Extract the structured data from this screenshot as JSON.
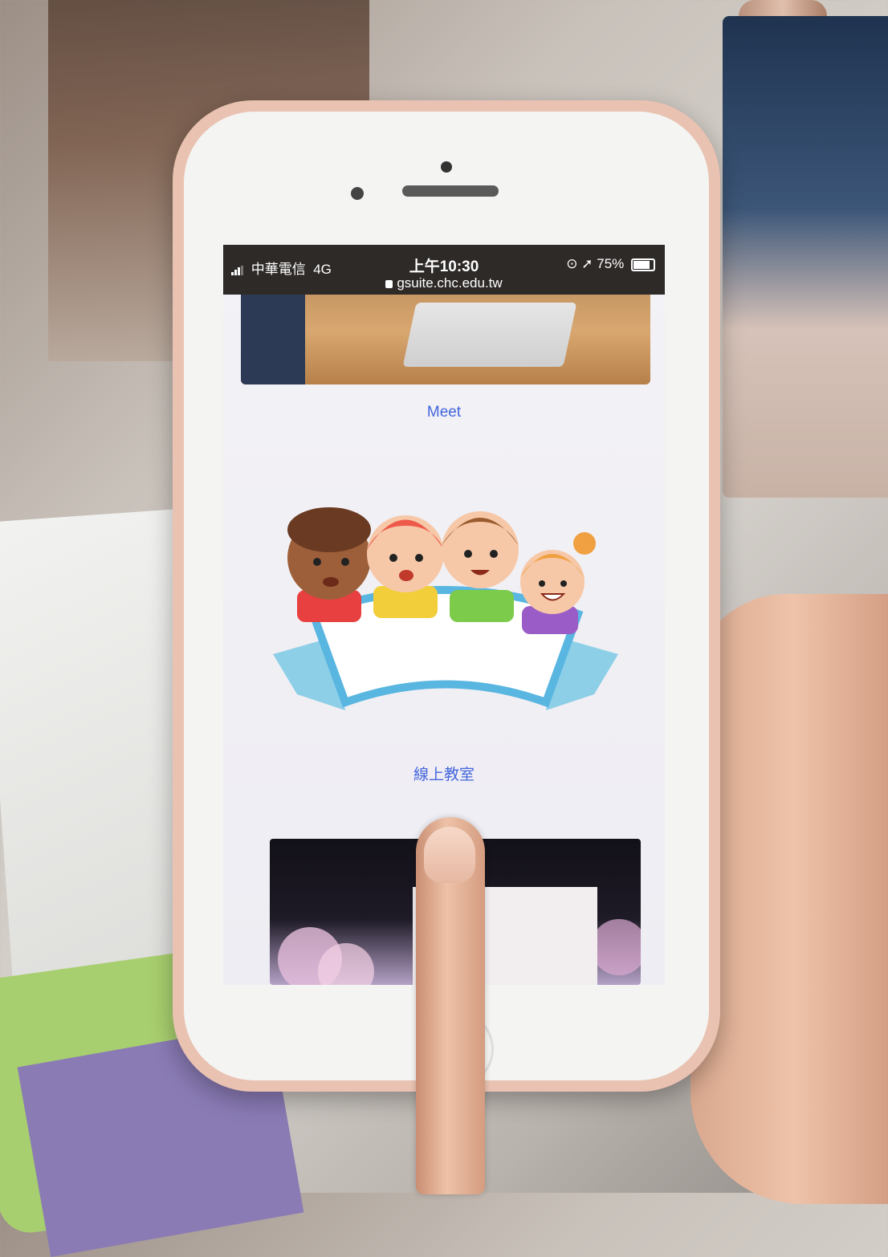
{
  "status_bar": {
    "carrier": "中華電信",
    "network": "4G",
    "time": "上午10:30",
    "url": "gsuite.chc.edu.tw",
    "battery": "75%"
  },
  "links": {
    "meet": "Meet",
    "classroom": "線上教室"
  },
  "colors": {
    "link": "#4466dd",
    "status_bar": "#2e2a28"
  }
}
